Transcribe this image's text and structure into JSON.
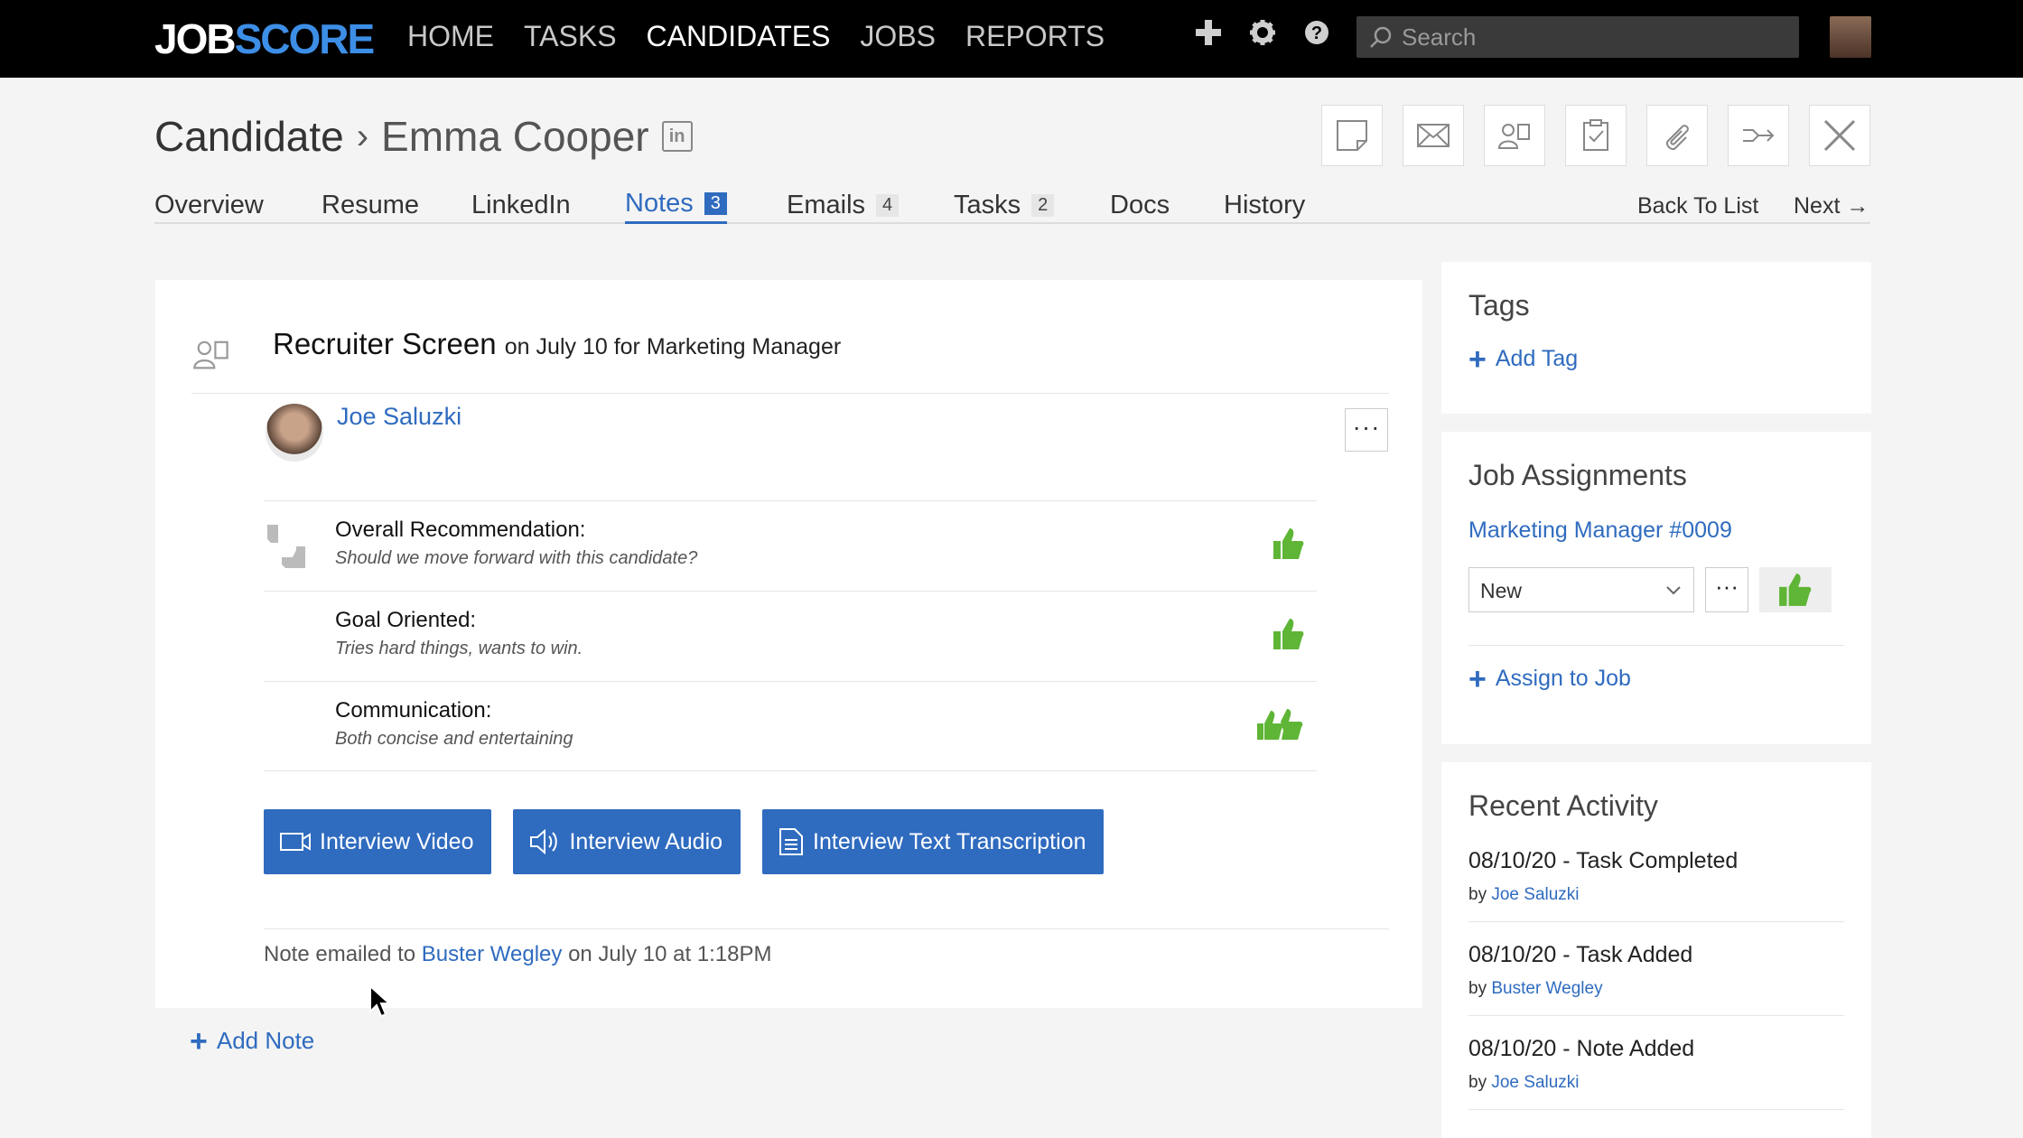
{
  "app": {
    "logo_part1": "JOB",
    "logo_part2": "SCORE"
  },
  "nav": {
    "items": [
      "HOME",
      "TASKS",
      "CANDIDATES",
      "JOBS",
      "REPORTS"
    ],
    "active": "CANDIDATES"
  },
  "search": {
    "placeholder": "Search"
  },
  "header": {
    "section": "Candidate",
    "separator": "›",
    "candidate_name": "Emma Cooper",
    "linkedin_badge": "in"
  },
  "tabs": [
    {
      "label": "Overview",
      "count": ""
    },
    {
      "label": "Resume",
      "count": ""
    },
    {
      "label": "LinkedIn",
      "count": ""
    },
    {
      "label": "Notes",
      "count": "3"
    },
    {
      "label": "Emails",
      "count": "4"
    },
    {
      "label": "Tasks",
      "count": "2"
    },
    {
      "label": "Docs",
      "count": ""
    },
    {
      "label": "History",
      "count": ""
    }
  ],
  "tab_nav": {
    "back": "Back To List",
    "next": "Next →"
  },
  "note": {
    "title": "Recruiter Screen",
    "meta": "on July 10 for Marketing Manager",
    "author": "Joe Saluzki",
    "more": "···",
    "ratings": [
      {
        "label": "Overall Recommendation:",
        "sub": "Should we move forward with this candidate?",
        "rating": "thumbs-up"
      },
      {
        "label": "Goal Oriented:",
        "sub": "Tries hard things, wants to win.",
        "rating": "thumbs-up"
      },
      {
        "label": "Communication:",
        "sub": "Both concise and entertaining",
        "rating": "two-thumbs-up"
      }
    ],
    "buttons": {
      "video": "Interview Video",
      "audio": "Interview Audio",
      "text": "Interview Text Transcription"
    },
    "footer": {
      "prefix": "Note emailed to",
      "recipient": "Buster Wegley",
      "suffix": "on July 10 at 1:18PM"
    }
  },
  "add_note": "Add Note",
  "sidebar": {
    "tags": {
      "title": "Tags",
      "add": "Add Tag"
    },
    "jobs": {
      "title": "Job Assignments",
      "job": "Marketing Manager #0009",
      "status": "New",
      "more": "···",
      "assign": "Assign to Job"
    },
    "activity": {
      "title": "Recent Activity",
      "items": [
        {
          "text": "08/10/20 - Task Completed",
          "by_prefix": "by",
          "by": "Joe Saluzki"
        },
        {
          "text": "08/10/20 - Task Added",
          "by_prefix": "by",
          "by": "Buster Wegley"
        },
        {
          "text": "08/10/20 - Note Added",
          "by_prefix": "by",
          "by": "Joe Saluzki"
        }
      ]
    }
  },
  "colors": {
    "accent": "#2f6bbf",
    "thumb": "#5fb536",
    "topbar": "#000000"
  }
}
